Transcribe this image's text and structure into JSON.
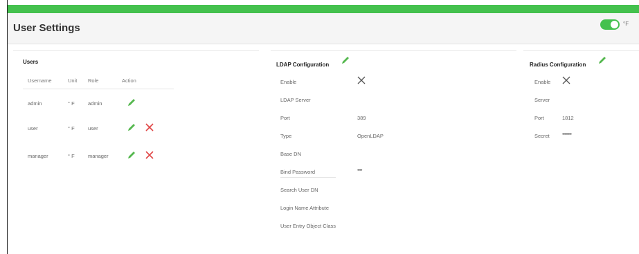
{
  "page_title": "User Settings",
  "unit_toggle": {
    "label": "°F",
    "on": true
  },
  "colors": {
    "accent": "#44c14e",
    "delete": "#e14848",
    "edit": "#55b84f"
  },
  "users_panel": {
    "title": "Users",
    "columns": [
      "Username",
      "Unit",
      "Role",
      "Action"
    ],
    "rows": [
      {
        "username": "admin",
        "unit": "° F",
        "role": "admin",
        "actions": [
          "edit"
        ]
      },
      {
        "username": "user",
        "unit": "° F",
        "role": "user",
        "actions": [
          "edit",
          "delete"
        ]
      },
      {
        "username": "manager",
        "unit": "° F",
        "role": "manager",
        "actions": [
          "edit",
          "delete"
        ]
      }
    ]
  },
  "ldap_panel": {
    "title": "LDAP Configuration",
    "fields": [
      {
        "label": "Enable",
        "value": "",
        "icon": "x-icon"
      },
      {
        "label": "LDAP Server",
        "value": ""
      },
      {
        "label": "Port",
        "value": "389"
      },
      {
        "label": "Type",
        "value": "OpenLDAP"
      },
      {
        "label": "Base DN",
        "value": ""
      },
      {
        "label": "Bind Password",
        "value": "••••"
      },
      {
        "label": "Search User DN",
        "value": ""
      },
      {
        "label": "Login Name Attribute",
        "value": ""
      },
      {
        "label": "User Entry Object Class",
        "value": ""
      }
    ]
  },
  "radius_panel": {
    "title": "Radius Configuration",
    "fields": [
      {
        "label": "Enable",
        "value": "",
        "icon": "x-icon"
      },
      {
        "label": "Server",
        "value": ""
      },
      {
        "label": "Port",
        "value": "1812"
      },
      {
        "label": "Secret",
        "value": "••••••••"
      }
    ]
  }
}
